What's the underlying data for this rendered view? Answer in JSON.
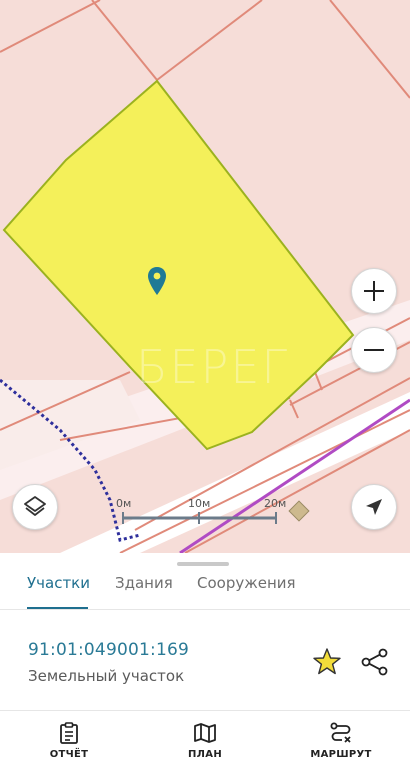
{
  "map": {
    "watermark": "БЕРЕГ",
    "scale": {
      "labels": [
        "0м",
        "10м",
        "20м"
      ]
    },
    "controls": {
      "zoom_in": "plus-icon",
      "zoom_out": "minus-icon",
      "layers": "layers-icon",
      "locate": "navigation-arrow-icon"
    },
    "colors": {
      "parcel_fill": "#f4f05a",
      "parcel_border": "#9bb21f",
      "background": "#f6ddd8",
      "boundary_lines": "#e08a7a",
      "route_line": "#b04bc4",
      "dotted_boundary": "#2e2f9c",
      "marker": "#1f7a96"
    }
  },
  "panel": {
    "tabs": [
      {
        "label": "Участки",
        "active": true
      },
      {
        "label": "Здания",
        "active": false
      },
      {
        "label": "Сооружения",
        "active": false
      }
    ],
    "parcel": {
      "cadastral_number": "91:01:049001:169",
      "type": "Земельный участок"
    },
    "actions": {
      "favorite": "star-icon",
      "share": "share-icon"
    },
    "accent_color": "#1f6f8f"
  },
  "bottom_nav": [
    {
      "label": "ОТЧЁТ",
      "icon": "clipboard-icon"
    },
    {
      "label": "ПЛАН",
      "icon": "map-icon"
    },
    {
      "label": "МАРШРУТ",
      "icon": "route-icon"
    }
  ]
}
